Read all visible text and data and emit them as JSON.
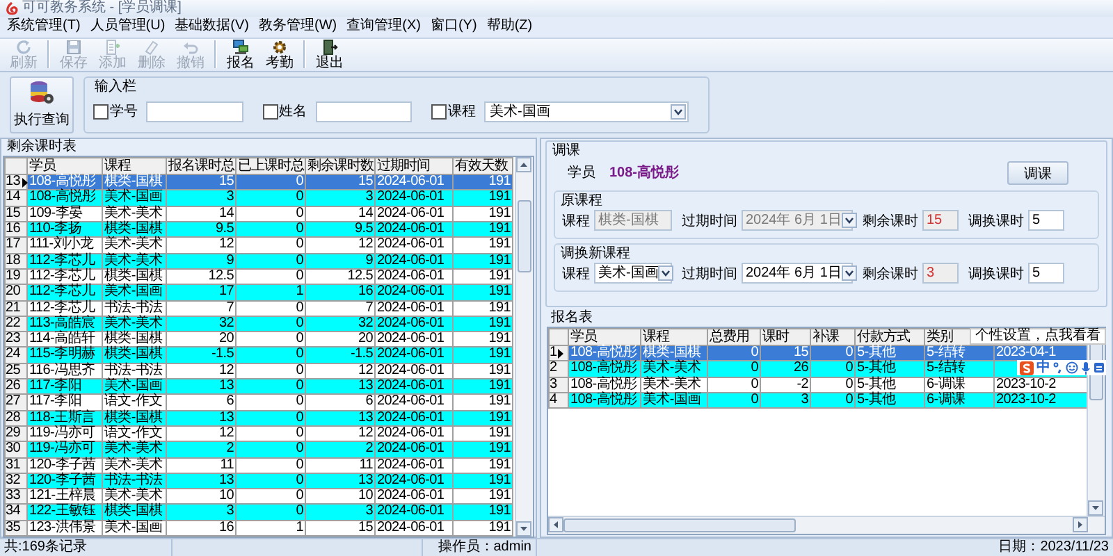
{
  "window": {
    "title": "可可教务系统 - [学员调课]"
  },
  "menu": [
    "系统管理(T)",
    "人员管理(U)",
    "基础数据(V)",
    "教务管理(W)",
    "查询管理(X)",
    "窗口(Y)",
    "帮助(Z)"
  ],
  "toolbar": [
    [
      {
        "label": "刷新",
        "kind": "refresh",
        "disabled": true
      }
    ],
    [
      {
        "label": "保存",
        "kind": "save",
        "disabled": true
      },
      {
        "label": "添加",
        "kind": "add",
        "disabled": true
      },
      {
        "label": "删除",
        "kind": "delete",
        "disabled": true
      },
      {
        "label": "撤销",
        "kind": "undo",
        "disabled": true
      }
    ],
    [
      {
        "label": "报名",
        "kind": "signup",
        "disabled": false
      },
      {
        "label": "考勤",
        "kind": "attendance",
        "disabled": false
      }
    ],
    [
      {
        "label": "退出",
        "kind": "exit",
        "disabled": false
      }
    ]
  ],
  "query": {
    "button": "执行查询",
    "title": "输入栏",
    "filters": [
      {
        "label": "学号",
        "checked": false,
        "kind": "text"
      },
      {
        "label": "姓名",
        "checked": false,
        "kind": "text"
      },
      {
        "label": "课程",
        "checked": false,
        "kind": "select",
        "value": "美术-国画"
      }
    ]
  },
  "remaining_table": {
    "title": "剩余课时表",
    "columns": [
      "学员",
      "课程",
      "报名课时总",
      "已上课时总",
      "剩余课时数",
      "过期时间",
      "有效天数"
    ],
    "rows": [
      {
        "no": "13",
        "cells": [
          "108-高悦彤",
          "棋类-国棋",
          "15",
          "0",
          "15",
          "2024-06-01",
          "191"
        ],
        "selected": true
      },
      {
        "no": "14",
        "cells": [
          "108-高悦彤",
          "美术-国画",
          "3",
          "0",
          "3",
          "2024-06-01",
          "191"
        ],
        "selected": false
      },
      {
        "no": "15",
        "cells": [
          "109-李晏",
          "美术-美术",
          "14",
          "0",
          "14",
          "2024-06-01",
          "191"
        ],
        "selected": false
      },
      {
        "no": "16",
        "cells": [
          "110-李扬",
          "棋类-国棋",
          "9.5",
          "0",
          "9.5",
          "2024-06-01",
          "191"
        ],
        "selected": false
      },
      {
        "no": "17",
        "cells": [
          "111-刘小龙",
          "美术-美术",
          "12",
          "0",
          "12",
          "2024-06-01",
          "191"
        ],
        "selected": false
      },
      {
        "no": "18",
        "cells": [
          "112-李芯儿",
          "美术-美术",
          "9",
          "0",
          "9",
          "2024-06-01",
          "191"
        ],
        "selected": false
      },
      {
        "no": "19",
        "cells": [
          "112-李芯儿",
          "棋类-国棋",
          "12.5",
          "0",
          "12.5",
          "2024-06-01",
          "191"
        ],
        "selected": false
      },
      {
        "no": "20",
        "cells": [
          "112-李芯儿",
          "美术-国画",
          "17",
          "1",
          "16",
          "2024-06-01",
          "191"
        ],
        "selected": false
      },
      {
        "no": "21",
        "cells": [
          "112-李芯儿",
          "书法-书法",
          "7",
          "0",
          "7",
          "2024-06-01",
          "191"
        ],
        "selected": false
      },
      {
        "no": "22",
        "cells": [
          "113-高皓宸",
          "美术-美术",
          "32",
          "0",
          "32",
          "2024-06-01",
          "191"
        ],
        "selected": false
      },
      {
        "no": "23",
        "cells": [
          "114-高皓轩",
          "棋类-国棋",
          "20",
          "0",
          "20",
          "2024-06-01",
          "191"
        ],
        "selected": false
      },
      {
        "no": "24",
        "cells": [
          "115-李明赫",
          "棋类-国棋",
          "-1.5",
          "0",
          "-1.5",
          "2024-06-01",
          "191"
        ],
        "selected": false
      },
      {
        "no": "25",
        "cells": [
          "116-冯思齐",
          "书法-书法",
          "12",
          "0",
          "12",
          "2024-06-01",
          "191"
        ],
        "selected": false
      },
      {
        "no": "26",
        "cells": [
          "117-李阳",
          "美术-国画",
          "13",
          "0",
          "13",
          "2024-06-01",
          "191"
        ],
        "selected": false
      },
      {
        "no": "27",
        "cells": [
          "117-李阳",
          "语文-作文",
          "6",
          "0",
          "6",
          "2024-06-01",
          "191"
        ],
        "selected": false
      },
      {
        "no": "28",
        "cells": [
          "118-王斯言",
          "棋类-国棋",
          "13",
          "0",
          "13",
          "2024-06-01",
          "191"
        ],
        "selected": false
      },
      {
        "no": "29",
        "cells": [
          "119-冯亦可",
          "语文-作文",
          "12",
          "0",
          "12",
          "2024-06-01",
          "191"
        ],
        "selected": false
      },
      {
        "no": "30",
        "cells": [
          "119-冯亦可",
          "美术-美术",
          "2",
          "0",
          "2",
          "2024-06-01",
          "191"
        ],
        "selected": false
      },
      {
        "no": "31",
        "cells": [
          "120-李子茜",
          "美术-美术",
          "11",
          "0",
          "11",
          "2024-06-01",
          "191"
        ],
        "selected": false
      },
      {
        "no": "32",
        "cells": [
          "120-李子茜",
          "书法-书法",
          "13",
          "0",
          "13",
          "2024-06-01",
          "191"
        ],
        "selected": false
      },
      {
        "no": "33",
        "cells": [
          "121-王梓晨",
          "美术-美术",
          "10",
          "0",
          "10",
          "2024-06-01",
          "191"
        ],
        "selected": false
      },
      {
        "no": "34",
        "cells": [
          "122-王敏钰",
          "棋类-国棋",
          "3",
          "0",
          "3",
          "2024-06-01",
          "191"
        ],
        "selected": false
      },
      {
        "no": "35",
        "cells": [
          "123-洪伟景",
          "美术-国画",
          "16",
          "1",
          "15",
          "2024-06-01",
          "191"
        ],
        "selected": false
      }
    ]
  },
  "transfer": {
    "title": "调课",
    "student_label": "学员",
    "student": "108-高悦彤",
    "button": "调课",
    "groups": [
      {
        "title": "原课程",
        "fields": [
          {
            "label": "课程",
            "value": "棋类-国棋",
            "kind": "text",
            "disabled": true
          },
          {
            "label": "过期时间",
            "value": "2024年 6月 1日",
            "kind": "date",
            "disabled": true
          },
          {
            "label": "剩余课时",
            "value": "15",
            "kind": "count",
            "disabled": true
          },
          {
            "label": "调换课时",
            "value": "5",
            "kind": "text",
            "disabled": false
          }
        ]
      },
      {
        "title": "调换新课程",
        "fields": [
          {
            "label": "课程",
            "value": "美术-国画",
            "kind": "select",
            "disabled": false
          },
          {
            "label": "过期时间",
            "value": "2024年 6月 1日",
            "kind": "date",
            "disabled": false
          },
          {
            "label": "剩余课时",
            "value": "3",
            "kind": "count",
            "disabled": true
          },
          {
            "label": "调换课时",
            "value": "5",
            "kind": "text",
            "disabled": false
          }
        ]
      }
    ]
  },
  "signup_table": {
    "title": "报名表",
    "columns": [
      "学员",
      "课程",
      "总费用",
      "课时",
      "补课",
      "付款方式",
      "类别"
    ],
    "rows": [
      {
        "no": "1",
        "cells": [
          "108-高悦彤",
          "棋类-国棋",
          "0",
          "15",
          "0",
          "5-其他",
          "5-结转",
          "2023-04-1"
        ],
        "selected": true
      },
      {
        "no": "2",
        "cells": [
          "108-高悦彤",
          "美术-美术",
          "0",
          "26",
          "0",
          "5-其他",
          "5-结转"
        ],
        "selected": false
      },
      {
        "no": "3",
        "cells": [
          "108-高悦彤",
          "美术-美术",
          "0",
          "-2",
          "0",
          "5-其他",
          "6-调课",
          "2023-10-2"
        ],
        "selected": false
      },
      {
        "no": "4",
        "cells": [
          "108-高悦彤",
          "美术-国画",
          "0",
          "3",
          "0",
          "5-其他",
          "6-调课",
          "2023-10-2"
        ],
        "selected": false
      }
    ]
  },
  "ime": {
    "tooltip": "个性设置，点我看看",
    "mode": "中"
  },
  "status_bar": {
    "records": "共:169条记录",
    "operator": "操作员：admin",
    "date": "日期：2023/11/23"
  }
}
